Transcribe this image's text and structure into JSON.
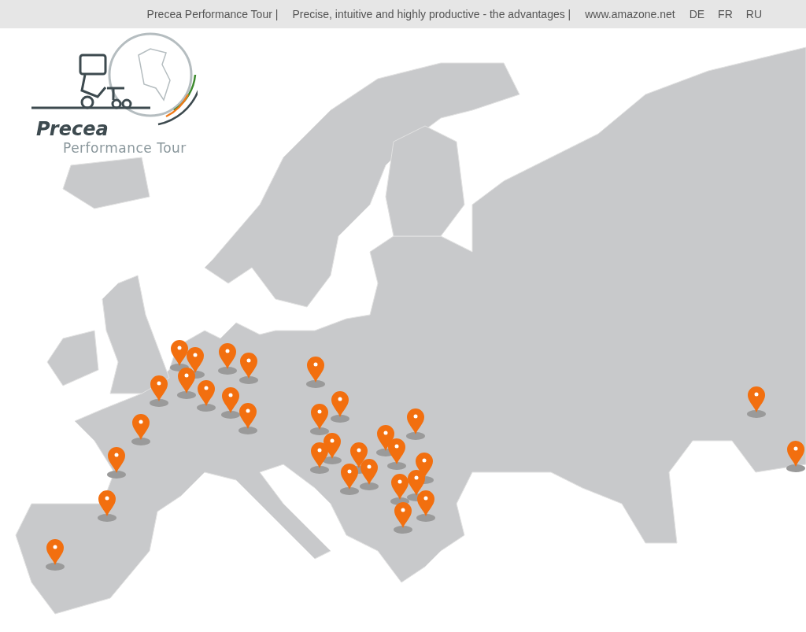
{
  "top_bar": {
    "links": [
      "Precea Performance Tour |",
      "Precise, intuitive and highly productive - the advantages |",
      "www.amazone.net"
    ],
    "languages": [
      "DE",
      "FR",
      "RU"
    ]
  },
  "logo": {
    "title": "Precea",
    "subtitle": "Performance Tour"
  }
}
